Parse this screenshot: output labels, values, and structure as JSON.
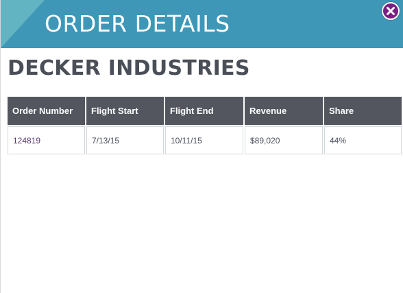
{
  "header": {
    "title": "ORDER DETAILS",
    "close_icon": "close-x-icon",
    "colors": {
      "header_bg": "#3f97b8",
      "header_accent": "#62b4c2",
      "close_button": "#7a1e86"
    }
  },
  "company": {
    "name": "DECKER INDUSTRIES"
  },
  "table": {
    "columns": [
      "Order Number",
      "Flight Start",
      "Flight End",
      "Revenue",
      "Share"
    ],
    "rows": [
      [
        "124819",
        "7/13/15",
        "10/11/15",
        "$89,020",
        "44%"
      ]
    ],
    "header_bg": "#53565e"
  }
}
